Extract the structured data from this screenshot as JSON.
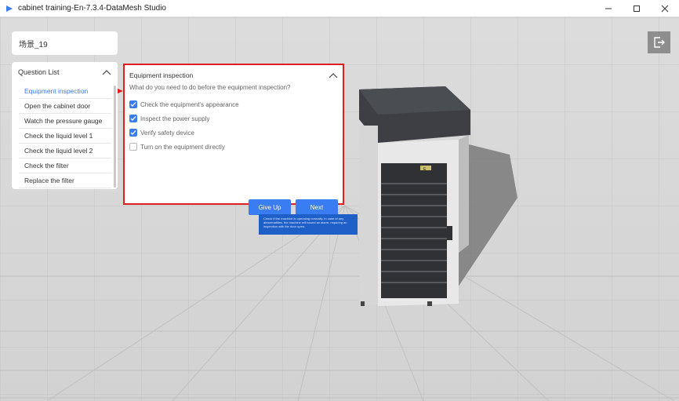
{
  "window": {
    "title": "cabinet training-En-7.3.4-DataMesh Studio"
  },
  "colors": {
    "accent": "#3a7cf2",
    "highlight_border": "#e02020",
    "tooltip_bg": "#1f5fc8"
  },
  "scene": {
    "name": "场景_19"
  },
  "question_list": {
    "title": "Question List",
    "items": [
      "Equipment inspection",
      "Open the cabinet door",
      "Watch the pressure gauge",
      "Check the liquid level 1",
      " Check the liquid level 2",
      "Check the filter",
      "Replace the filter"
    ],
    "active_index": 0
  },
  "panel": {
    "title": "Equipment inspection",
    "question": "What do you need to do before the equipment inspection?",
    "options": [
      {
        "label": "Check the equipment's appearance",
        "checked": true
      },
      {
        "label": "Inspect the power supply",
        "checked": true
      },
      {
        "label": "Verify safety device",
        "checked": true
      },
      {
        "label": "Turn on the equipment directly",
        "checked": false
      }
    ],
    "give_up_label": "Give Up",
    "next_label": "Next"
  },
  "tooltip": {
    "text": "Check if the machine is operating normally. In case of any abnormalities, the machine will sound an alarm, requiring an inspection with the door open."
  },
  "device": {
    "label": "E"
  }
}
